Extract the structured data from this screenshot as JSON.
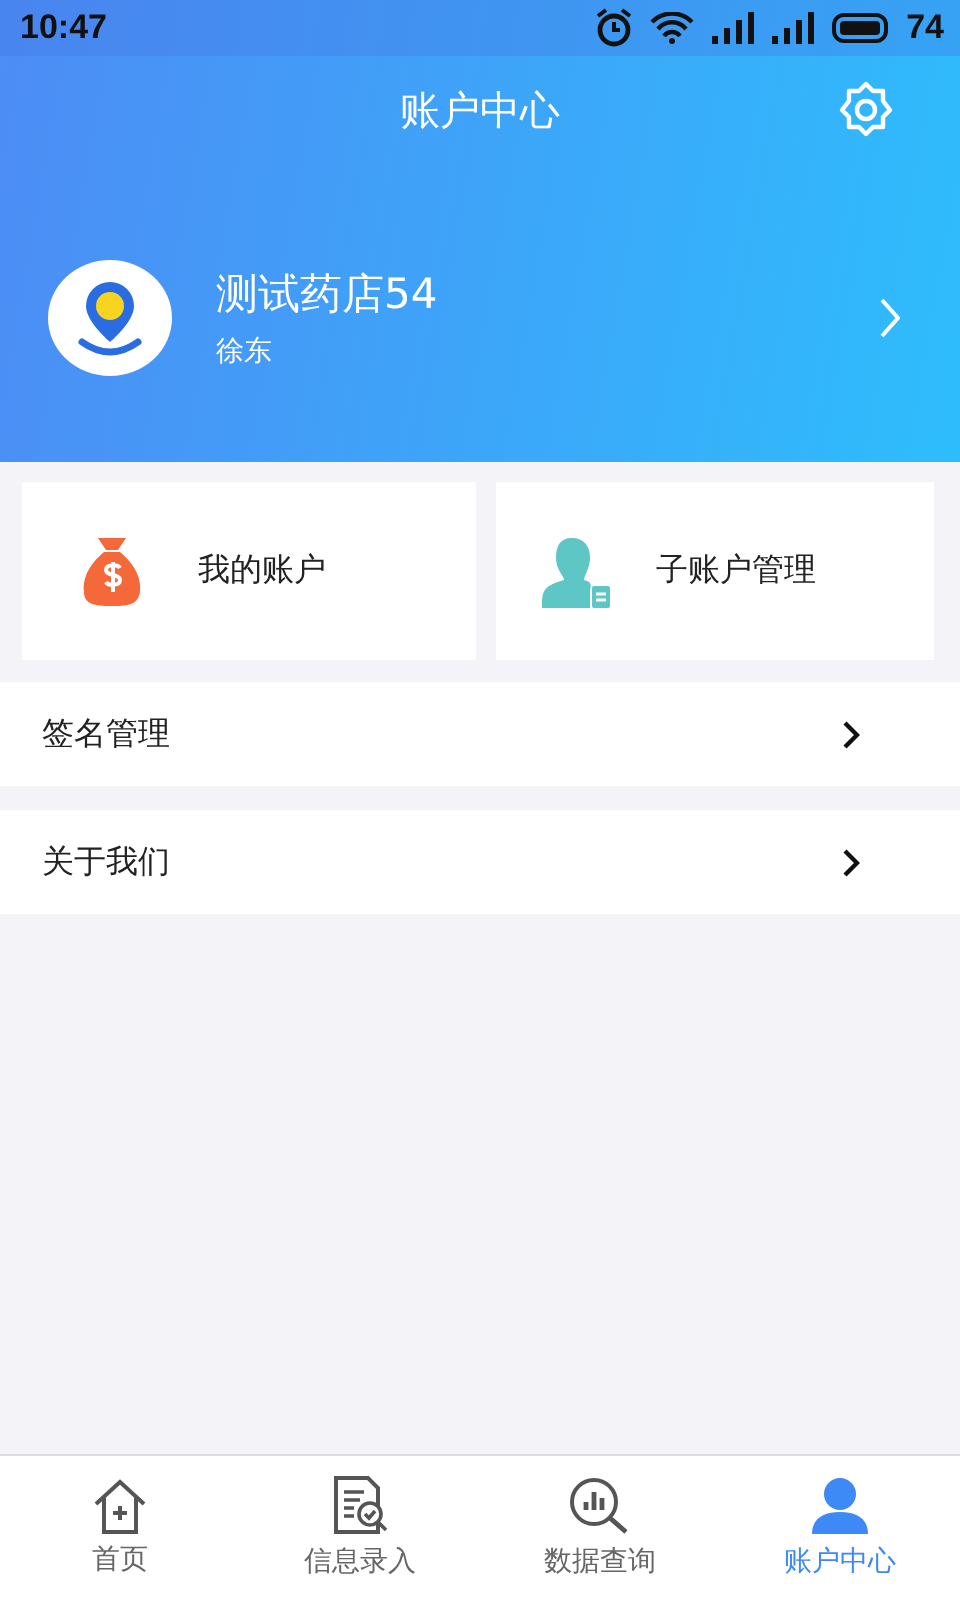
{
  "status_bar": {
    "time": "10:47",
    "battery": "74"
  },
  "header": {
    "title": "账户中心"
  },
  "profile": {
    "name": "测试药店54",
    "user": "徐东"
  },
  "cards": [
    {
      "label": "我的账户"
    },
    {
      "label": "子账户管理"
    }
  ],
  "menu": [
    {
      "label": "签名管理"
    },
    {
      "label": "关于我们"
    }
  ],
  "tabs": [
    {
      "label": "首页",
      "selected": false
    },
    {
      "label": "信息录入",
      "selected": false
    },
    {
      "label": "数据查询",
      "selected": false
    },
    {
      "label": "账户中心",
      "selected": true
    }
  ]
}
